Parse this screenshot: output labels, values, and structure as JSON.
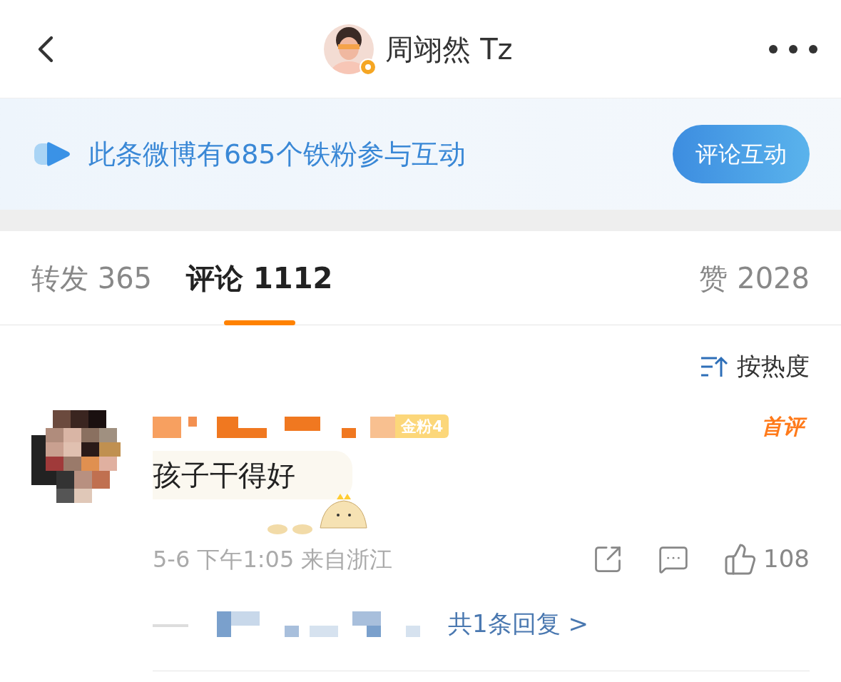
{
  "header": {
    "title": "周翊然 Tz",
    "verified": true
  },
  "banner": {
    "text": "此条微博有685个铁粉参与互动",
    "button": "评论互动"
  },
  "tabs": [
    {
      "label": "转发",
      "count": "365",
      "selected": false
    },
    {
      "label": "评论",
      "count": "1112",
      "selected": true
    },
    {
      "label": "赞",
      "count": "2028",
      "selected": false
    }
  ],
  "sort": {
    "label": "按热度"
  },
  "comments": [
    {
      "badge": "金粉4",
      "tag": "首评",
      "text": "孩子干得好",
      "time": "5-6 下午1:05 来自浙江",
      "likes": "108",
      "replies": "共1条回复 >"
    }
  ]
}
